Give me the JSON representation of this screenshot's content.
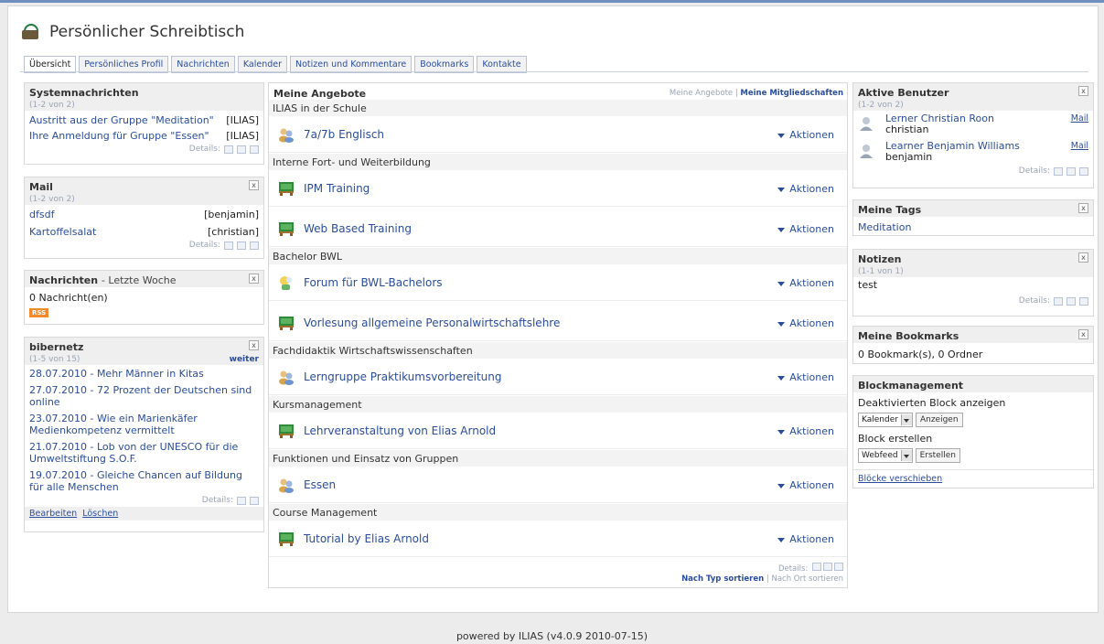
{
  "page": {
    "title": "Persönlicher Schreibtisch"
  },
  "tabs": [
    "Übersicht",
    "Persönliches Profil",
    "Nachrichten",
    "Kalender",
    "Notizen und Kommentare",
    "Bookmarks",
    "Kontakte"
  ],
  "left": {
    "systemnachrichten": {
      "title": "Systemnachrichten",
      "count": "(1-2 von 2)",
      "items": [
        {
          "text": "Austritt aus der Gruppe \"Meditation\"",
          "src": "[ILIAS]"
        },
        {
          "text": "Ihre Anmeldung für Gruppe \"Essen\"",
          "src": "[ILIAS]"
        }
      ],
      "details": "Details:"
    },
    "mail": {
      "title": "Mail",
      "count": "(1-2 von 2)",
      "items": [
        {
          "subject": "dfsdf",
          "from": "[benjamin]"
        },
        {
          "subject": "Kartoffelsalat",
          "from": "[christian]"
        }
      ],
      "details": "Details:"
    },
    "nachrichten": {
      "title": "Nachrichten",
      "subtitle": "- Letzte Woche",
      "text": "0 Nachricht(en)",
      "rss": "RSS"
    },
    "bibernetz": {
      "title": "bibernetz",
      "count": "(1-5 von 15)",
      "more": "weiter",
      "items": [
        "28.07.2010 - Mehr Männer in Kitas",
        "27.07.2010 - 72 Prozent der Deutschen sind online",
        "23.07.2010 - Wie ein Marienkäfer Medienkompetenz vermittelt",
        "21.07.2010 - Lob von der UNESCO für die Umweltstiftung S.O.F.",
        "19.07.2010 - Gleiche Chancen auf Bildung für alle Menschen"
      ],
      "details": "Details:",
      "edit": "Bearbeiten",
      "delete": "Löschen"
    }
  },
  "main": {
    "title": "Meine Angebote",
    "link1": "Meine Angebote",
    "link2": "Meine Mitgliedschaften",
    "action_label": "Aktionen",
    "categories": [
      {
        "name": "ILIAS in der Schule",
        "items": [
          {
            "name": "7a/7b Englisch",
            "icon": "group-icon"
          }
        ]
      },
      {
        "name": "Interne Fort- und Weiterbildung",
        "items": [
          {
            "name": "IPM Training",
            "icon": "course-icon"
          },
          {
            "name": "Web Based Training",
            "icon": "course-icon"
          }
        ]
      },
      {
        "name": "Bachelor BWL",
        "items": [
          {
            "name": "Forum für BWL-Bachelors",
            "icon": "forum-icon"
          },
          {
            "name": "Vorlesung allgemeine Personalwirtschaftslehre",
            "icon": "course-icon"
          }
        ]
      },
      {
        "name": "Fachdidaktik Wirtschaftswissenschaften",
        "items": [
          {
            "name": "Lerngruppe Praktikumsvorbereitung",
            "icon": "group-icon"
          }
        ]
      },
      {
        "name": "Kursmanagement",
        "items": [
          {
            "name": "Lehrveranstaltung von Elias Arnold",
            "icon": "course-icon"
          }
        ]
      },
      {
        "name": "Funktionen und Einsatz von Gruppen",
        "items": [
          {
            "name": "Essen",
            "icon": "group-icon"
          }
        ]
      },
      {
        "name": "Course Management",
        "items": [
          {
            "name": "Tutorial by Elias Arnold",
            "icon": "course-icon"
          }
        ]
      }
    ],
    "details": "Details:",
    "sort_type": "Nach Typ sortieren",
    "sort_place": "Nach Ort sortieren"
  },
  "right": {
    "aktive": {
      "title": "Aktive Benutzer",
      "count": "(1-2 von 2)",
      "users": [
        {
          "name": "Lerner Christian Roon",
          "login": "christian",
          "mail": "Mail"
        },
        {
          "name": "Learner Benjamin Williams",
          "login": "benjamin",
          "mail": "Mail"
        }
      ],
      "details": "Details:"
    },
    "tags": {
      "title": "Meine Tags",
      "item": "Meditation"
    },
    "notizen": {
      "title": "Notizen",
      "count": "(1-1 von 1)",
      "item": "test",
      "details": "Details:"
    },
    "bookmarks": {
      "title": "Meine Bookmarks",
      "text": "0 Bookmark(s), 0 Ordner"
    },
    "blockmgmt": {
      "title": "Blockmanagement",
      "label1": "Deaktivierten Block anzeigen",
      "select1": "Kalender",
      "btn1": "Anzeigen",
      "label2": "Block erstellen",
      "select2": "Webfeed",
      "btn2": "Erstellen",
      "move": "Blöcke verschieben"
    }
  },
  "footer": "powered by ILIAS (v4.0.9 2010-07-15)"
}
